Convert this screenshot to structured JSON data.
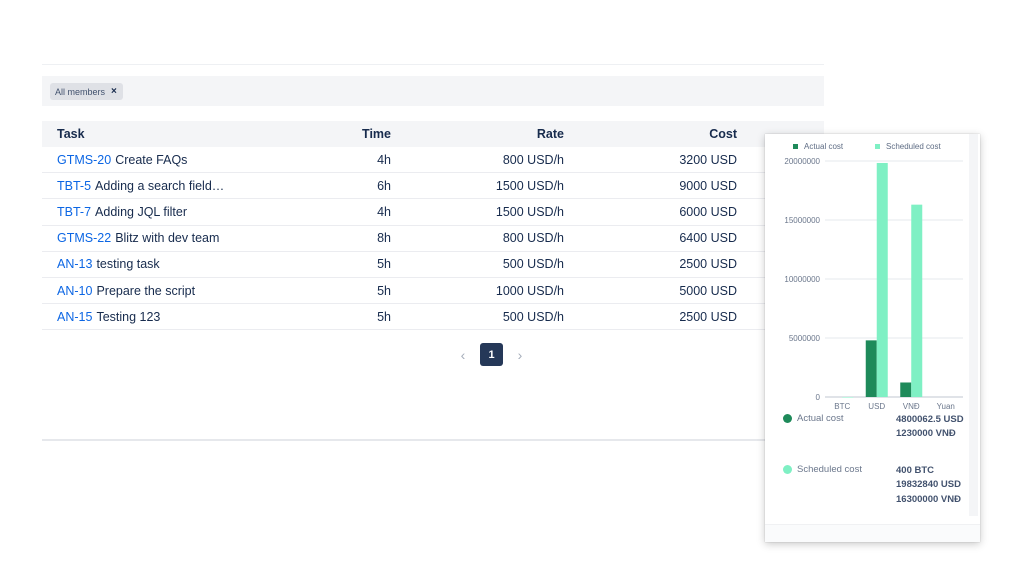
{
  "filter": {
    "chip_label": "All members",
    "remove_icon": "×"
  },
  "table": {
    "headers": {
      "task": "Task",
      "time": "Time",
      "rate": "Rate",
      "cost": "Cost"
    },
    "rows": [
      {
        "key": "GTMS-20",
        "summary": "Create FAQs",
        "time": "4h",
        "rate": "800 USD/h",
        "cost": "3200 USD"
      },
      {
        "key": "TBT-5",
        "summary": "Adding a search field…",
        "time": "6h",
        "rate": "1500 USD/h",
        "cost": "9000 USD"
      },
      {
        "key": "TBT-7",
        "summary": "Adding JQL filter",
        "time": "4h",
        "rate": "1500 USD/h",
        "cost": "6000 USD"
      },
      {
        "key": "GTMS-22",
        "summary": "Blitz with dev team",
        "time": "8h",
        "rate": "800 USD/h",
        "cost": "6400 USD"
      },
      {
        "key": "AN-13",
        "summary": "testing task",
        "time": "5h",
        "rate": "500 USD/h",
        "cost": "2500 USD"
      },
      {
        "key": "AN-10",
        "summary": "Prepare the script",
        "time": "5h",
        "rate": "1000 USD/h",
        "cost": "5000 USD"
      },
      {
        "key": "AN-15",
        "summary": "Testing 123",
        "time": "5h",
        "rate": "500 USD/h",
        "cost": "2500 USD"
      }
    ]
  },
  "pagination": {
    "prev_icon": "‹",
    "current_page": "1",
    "next_icon": "›"
  },
  "colors": {
    "actual": "#1e8a5a",
    "scheduled": "#7ff0c4",
    "link": "#0c66e4",
    "page_active": "#253858"
  },
  "chart_data": {
    "type": "bar",
    "categories": [
      "BTC",
      "USD",
      "VNĐ",
      "Yuan"
    ],
    "series": [
      {
        "name": "Actual cost",
        "values": [
          0,
          4800062.5,
          1230000,
          0
        ]
      },
      {
        "name": "Scheduled cost",
        "values": [
          400,
          19832840,
          16300000,
          0
        ]
      }
    ],
    "ylim": [
      0,
      20000000
    ],
    "yticks": [
      "0",
      "5000000",
      "10000000",
      "15000000",
      "20000000"
    ],
    "legend": "top",
    "grid": true
  },
  "totals": {
    "actual": {
      "label": "Actual cost",
      "values": [
        "4800062.5 USD",
        "1230000 VNĐ"
      ]
    },
    "scheduled": {
      "label": "Scheduled cost",
      "values": [
        "400 BTC",
        "19832840 USD",
        "16300000 VNĐ"
      ]
    }
  }
}
